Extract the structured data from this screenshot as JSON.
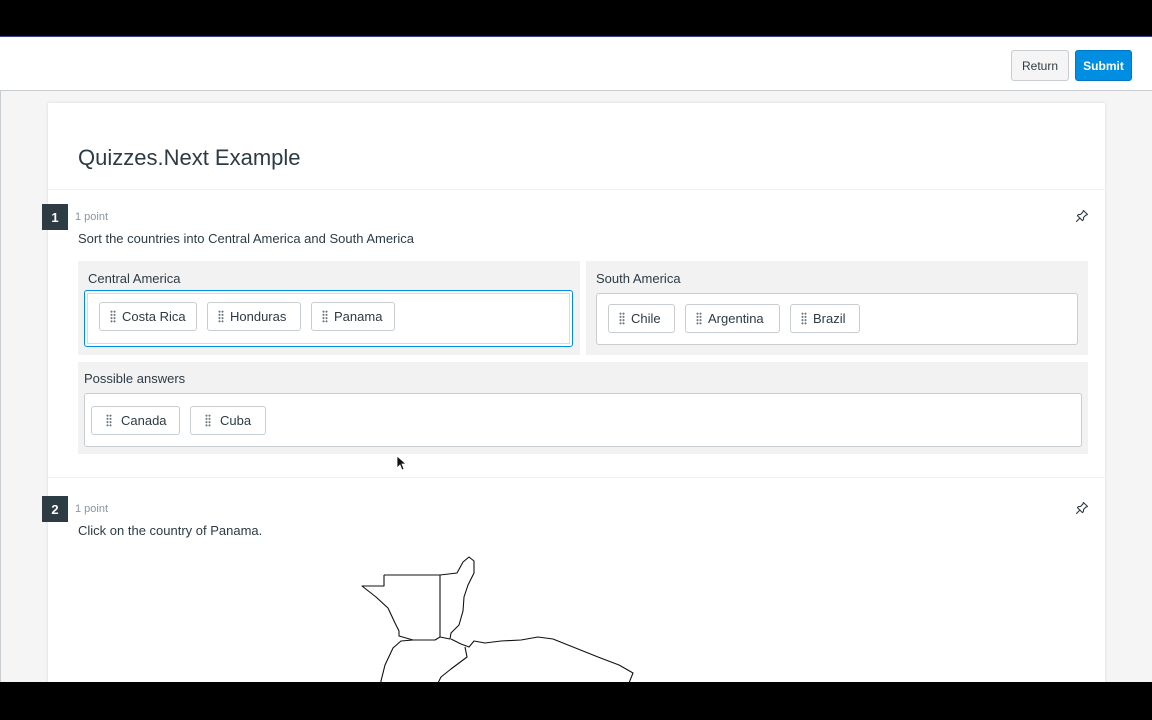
{
  "toolbar": {
    "return_label": "Return",
    "submit_label": "Submit"
  },
  "quiz": {
    "title": "Quizzes.Next Example"
  },
  "questions": [
    {
      "number": "1",
      "points": "1 point",
      "prompt": "Sort the countries into Central America and South America",
      "categories": [
        {
          "label": "Central America",
          "items": [
            "Costa Rica",
            "Honduras",
            "Panama"
          ]
        },
        {
          "label": "South America",
          "items": [
            "Chile",
            "Argentina",
            "Brazil"
          ]
        }
      ],
      "possible": {
        "label": "Possible answers",
        "items": [
          "Canada",
          "Cuba"
        ]
      }
    },
    {
      "number": "2",
      "points": "1 point",
      "prompt": "Click on the country of Panama."
    }
  ],
  "colors": {
    "accent": "#008ee2",
    "text": "#2d3b45",
    "muted": "#8b969e",
    "category_bg": "#f2f2f2"
  },
  "icons": {
    "pin": "pin-icon",
    "grip": "drag-handle-icon",
    "cursor": "mouse-pointer-icon"
  }
}
